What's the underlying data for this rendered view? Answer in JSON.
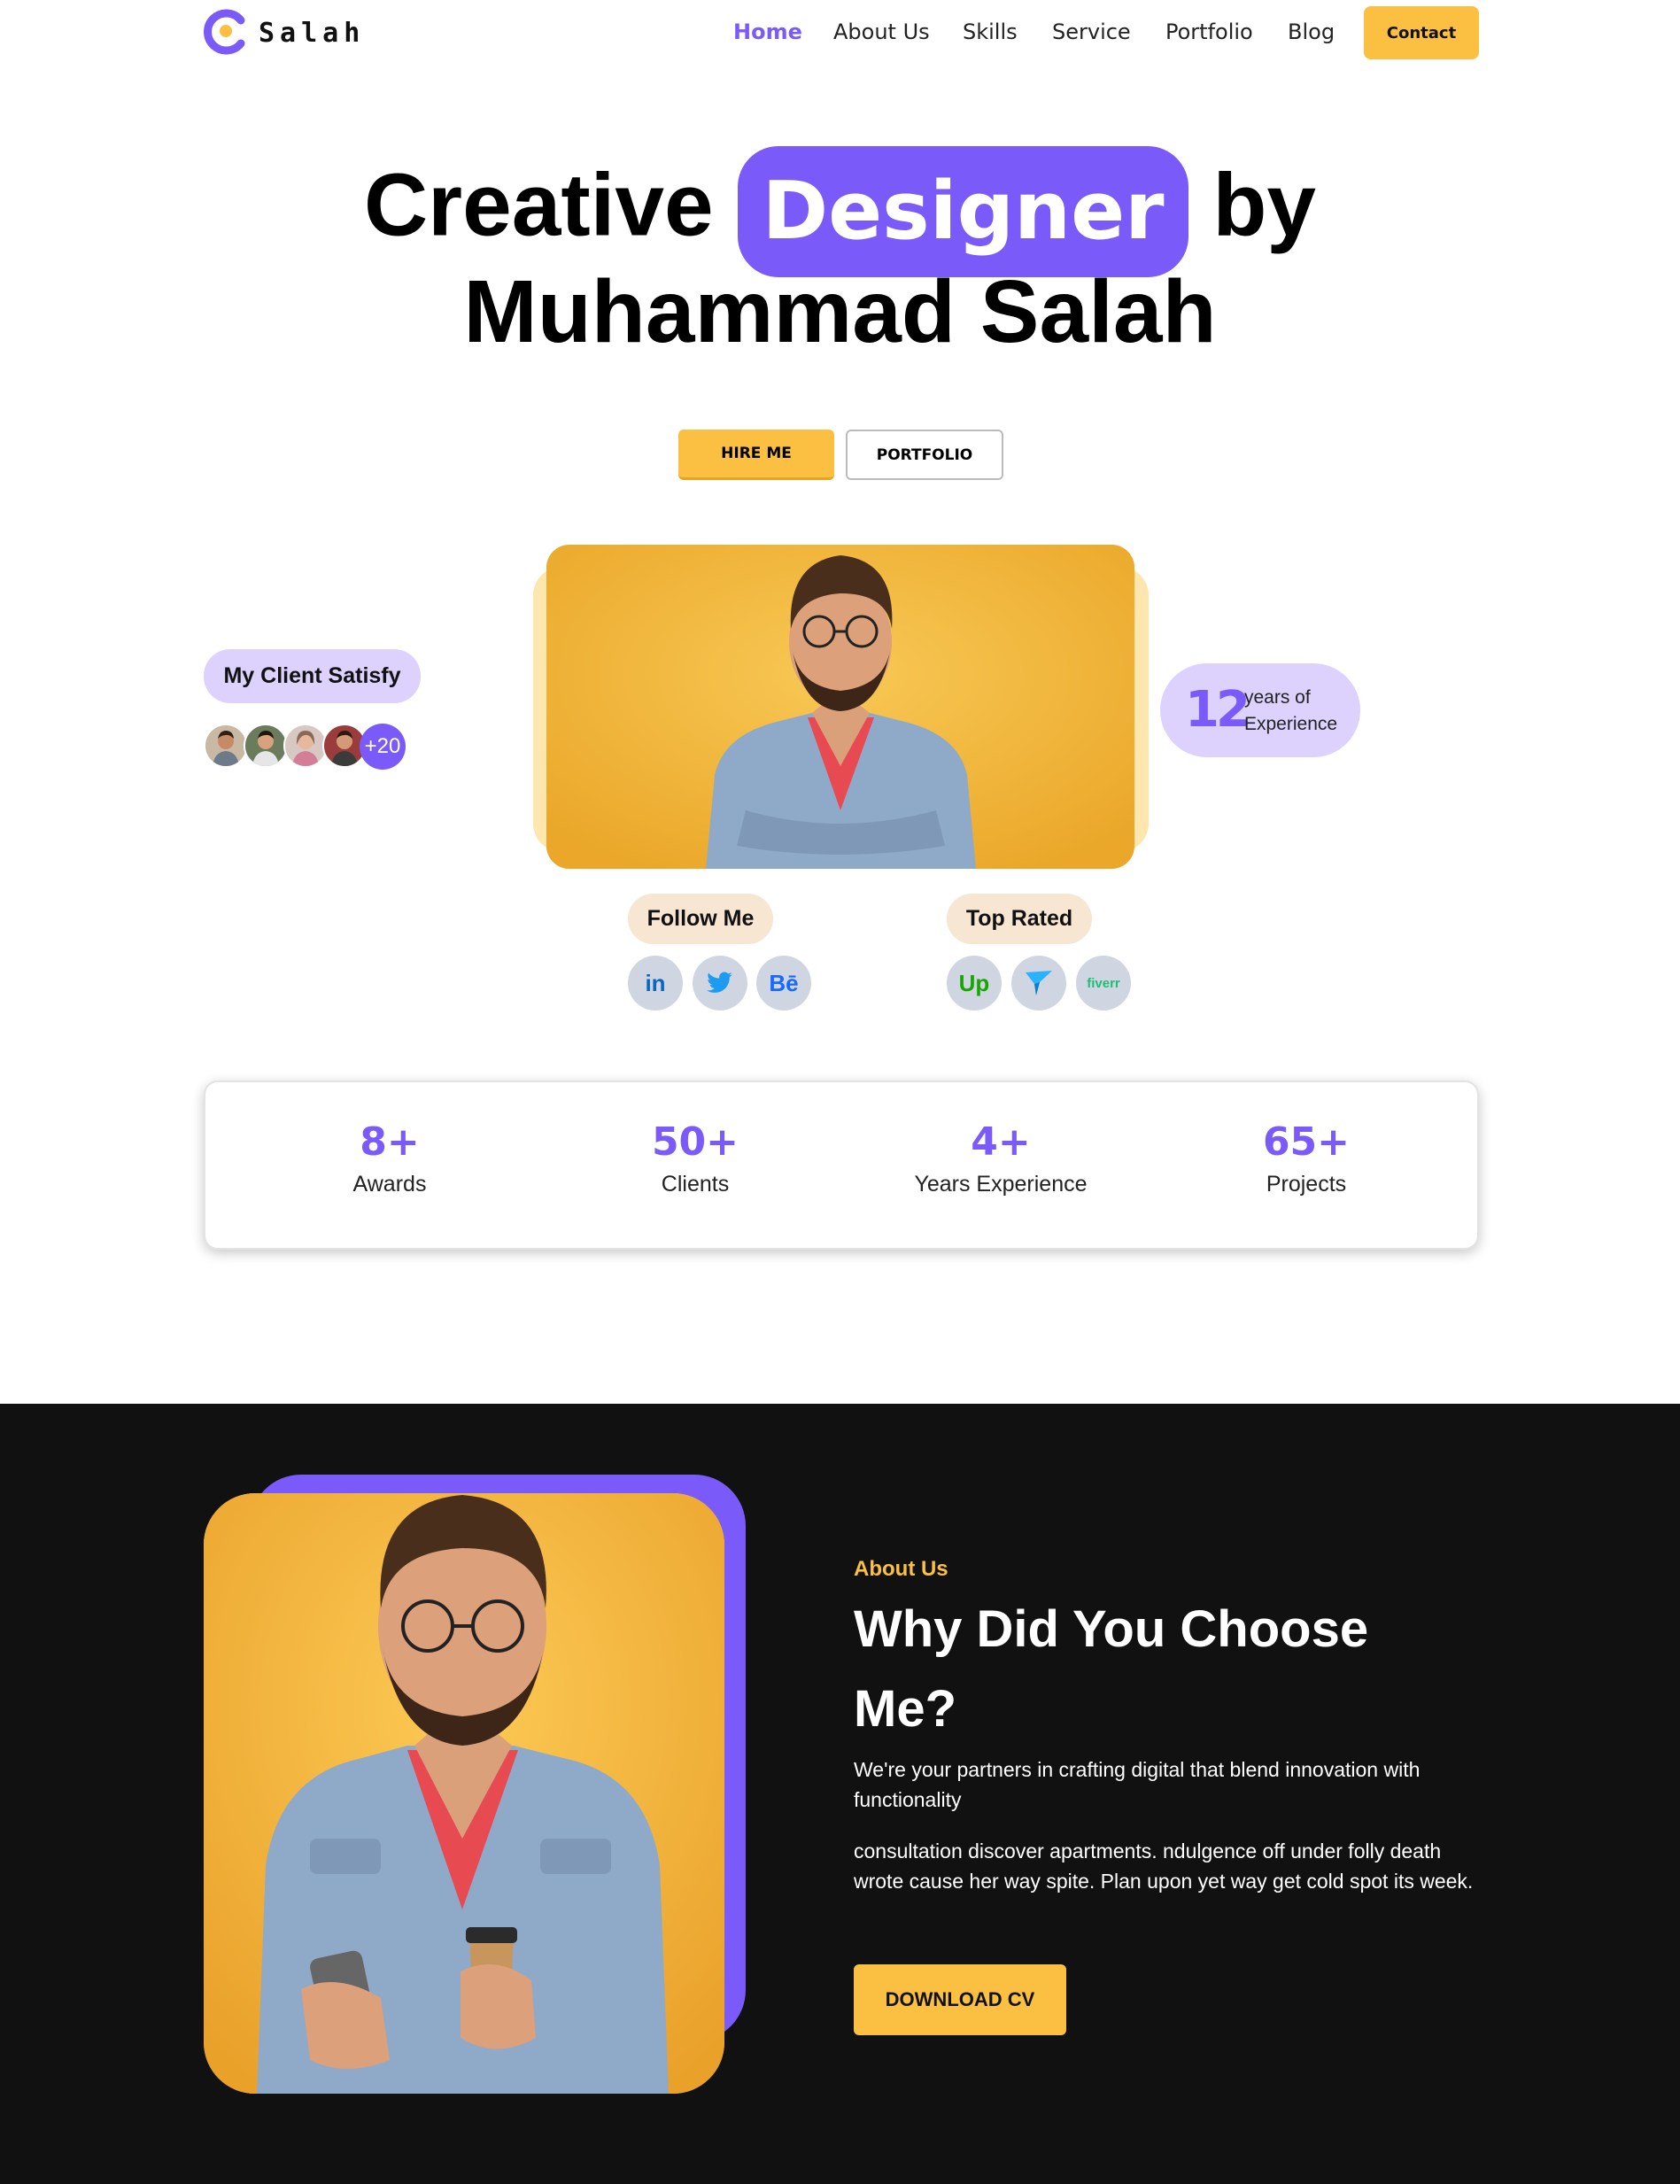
{
  "nav": {
    "logo_text": "Salah",
    "links": [
      "Home",
      "About Us",
      "Skills",
      "Service",
      "Portfolio",
      "Blog"
    ],
    "active": "Home",
    "contact_label": "Contact"
  },
  "hero": {
    "title_word1": "Creative",
    "title_highlight": "Designer",
    "title_word3": "by",
    "title_line2": "Muhammad Salah",
    "hire_label": "HIRE ME",
    "portfolio_label": "PORTFOLIO"
  },
  "clients": {
    "badge": "My Client Satisfy",
    "more": "+20"
  },
  "experience": {
    "number": "12",
    "label": "years of Experience"
  },
  "follow": {
    "label": "Follow Me",
    "icons": [
      "linkedin-icon",
      "twitter-icon",
      "behance-icon"
    ],
    "linkedin_text": "in",
    "behance_text": "Bē"
  },
  "top_rated": {
    "label": "Top Rated",
    "icons": [
      "upwork-icon",
      "freelancer-icon",
      "fiverr-icon"
    ],
    "upwork_text": "Up",
    "fiverr_text": "fiverr"
  },
  "stats": [
    {
      "num": "8+",
      "label": "Awards"
    },
    {
      "num": "50+",
      "label": "Clients"
    },
    {
      "num": "4+",
      "label": "Years Experience"
    },
    {
      "num": "65+",
      "label": "Projects"
    }
  ],
  "about": {
    "tag": "About Us",
    "title": "Why Did You Choose Me?",
    "p1": "We're your partners in crafting digital that blend innovation with functionality",
    "p2": "consultation discover apartments. ndulgence off under folly death wrote cause her way spite. Plan upon yet way get cold spot its week.",
    "cv_label": "DOWNLOAD CV"
  },
  "colors": {
    "accent": "#7a5af8",
    "yellow": "#fbc041",
    "dark": "#111111",
    "lavender": "#dcd2fd",
    "beige": "#f7e6d2"
  }
}
